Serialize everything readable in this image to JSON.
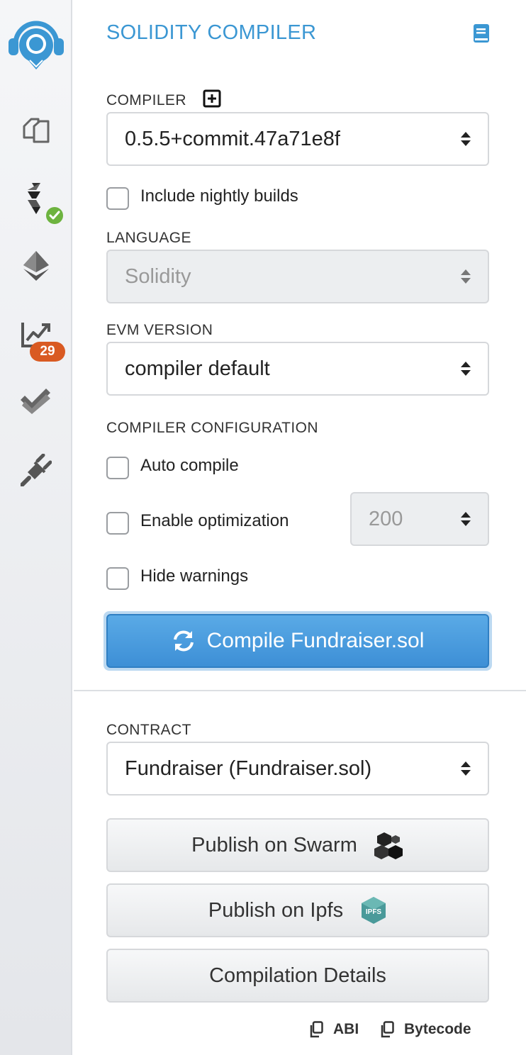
{
  "rail": {
    "items": [
      "remix-logo-icon",
      "file-explorer-icon",
      "solidity-compiler-icon",
      "deploy-run-icon",
      "analysis-icon",
      "testing-icon",
      "plugin-manager-icon"
    ],
    "analysis_badge": "29"
  },
  "header": {
    "title": "SOLIDITY COMPILER"
  },
  "compiler": {
    "label": "COMPILER",
    "version": "0.5.5+commit.47a71e8f",
    "nightly_label": "Include nightly builds"
  },
  "language": {
    "label": "LANGUAGE",
    "value": "Solidity"
  },
  "evm": {
    "label": "EVM VERSION",
    "value": "compiler default"
  },
  "config": {
    "label": "COMPILER CONFIGURATION",
    "auto_compile": "Auto compile",
    "optimization": "Enable optimization",
    "runs": "200",
    "hide_warnings": "Hide warnings"
  },
  "compile_button": "Compile Fundraiser.sol",
  "contract": {
    "label": "CONTRACT",
    "value": "Fundraiser (Fundraiser.sol)",
    "publish_swarm": "Publish on Swarm",
    "publish_ipfs": "Publish on Ipfs",
    "details": "Compilation Details",
    "abi": "ABI",
    "bytecode": "Bytecode"
  },
  "colors": {
    "accent": "#3b97d3",
    "badge": "#d95a22",
    "success": "#6db33f"
  }
}
